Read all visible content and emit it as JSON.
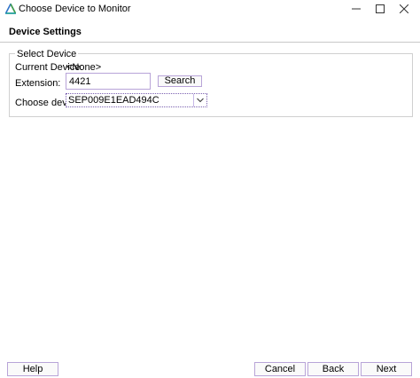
{
  "window": {
    "title": "Choose Device to Monitor",
    "icons": {
      "app": "triangle-logo-icon",
      "minimize": "minimize-icon",
      "maximize": "maximize-icon",
      "close": "close-icon"
    }
  },
  "header": {
    "title": "Device Settings"
  },
  "select_device": {
    "group_title": "Select Device",
    "current_device_label": "Current Device:",
    "current_device_value": "<None>",
    "extension_label": "Extension:",
    "extension_value": "4421",
    "search_label": "Search",
    "choose_device_label": "Choose device:",
    "choose_device_value": "SEP009E1EAD494C"
  },
  "footer": {
    "help_label": "Help",
    "cancel_label": "Cancel",
    "back_label": "Back",
    "next_label": "Next"
  },
  "colors": {
    "accent_border": "#b8a4d8",
    "focus_border": "#7a5fb0",
    "logo_blue": "#2f73c9",
    "logo_green": "#43a047",
    "logo_teal": "#26a69a"
  }
}
